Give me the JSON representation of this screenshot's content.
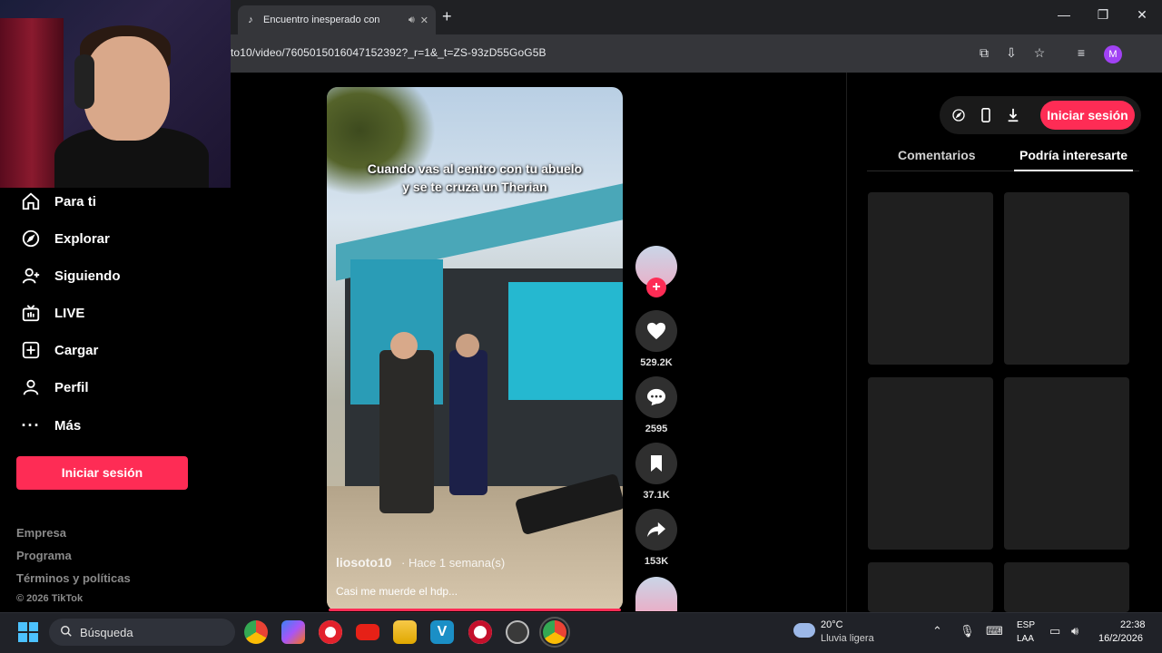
{
  "browser": {
    "tab_title": "Encuentro inesperado con",
    "url": "to10/video/7605015016047152392?_r=1&_t=ZS-93zD55GoG5B",
    "new_tab": "+",
    "profile_initial": "M"
  },
  "sidebar": {
    "items": [
      {
        "label": "Para ti",
        "icon": "home-icon"
      },
      {
        "label": "Explorar",
        "icon": "compass-icon"
      },
      {
        "label": "Siguiendo",
        "icon": "following-icon"
      },
      {
        "label": "LIVE",
        "icon": "live-icon"
      },
      {
        "label": "Cargar",
        "icon": "upload-icon"
      },
      {
        "label": "Perfil",
        "icon": "profile-icon"
      },
      {
        "label": "Más",
        "icon": "more-icon"
      }
    ],
    "login_label": "Iniciar sesión",
    "footer_links": [
      "Empresa",
      "Programa",
      "Términos y políticas"
    ],
    "copyright": "© 2026 TikTok"
  },
  "video": {
    "caption_line1": "Cuando vas al centro con tu abuelo",
    "caption_line2": "y se te cruza un Therian",
    "author": "liosoto10",
    "posted": "· Hace 1 semana(s)",
    "description": "Casi me muerde el hdp..."
  },
  "actions": {
    "likes": "529.2K",
    "comments": "2595",
    "saves": "37.1K",
    "shares": "153K"
  },
  "right_panel": {
    "login_label": "Iniciar sesión",
    "tab_comments": "Comentarios",
    "tab_recommended": "Podría interesarte"
  },
  "taskbar": {
    "search_placeholder": "Búsqueda",
    "temperature": "20°C",
    "weather": "Lluvia ligera",
    "lang_line1": "ESP",
    "lang_line2": "LAA",
    "time": "22:38",
    "date": "16/2/2026"
  },
  "colors": {
    "accent": "#fe2c55",
    "background": "#000000",
    "chrome": "#35363a"
  }
}
